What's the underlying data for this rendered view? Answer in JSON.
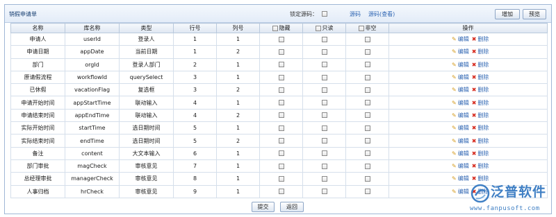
{
  "header": {
    "title": "销假申请单",
    "lock_label": "锁定源码：",
    "source_link": "源码",
    "source_view_link": "源码(查看)",
    "add_label": "增加",
    "preview_label": "预览"
  },
  "table": {
    "columns": [
      "名称",
      "库名称",
      "类型",
      "行号",
      "列号",
      "隐藏",
      "只读",
      "非空",
      "操作"
    ],
    "edit_label": "编辑",
    "delete_label": "删除",
    "rows": [
      {
        "name": "申请人",
        "db": "userId",
        "type": "登录人",
        "row": "1",
        "col": "1"
      },
      {
        "name": "申请日期",
        "db": "appDate",
        "type": "当前日期",
        "row": "1",
        "col": "2"
      },
      {
        "name": "部门",
        "db": "orgId",
        "type": "登录人部门",
        "row": "2",
        "col": "1"
      },
      {
        "name": "原请假流程",
        "db": "workflowId",
        "type": "querySelect",
        "row": "3",
        "col": "1"
      },
      {
        "name": "已休假",
        "db": "vacationFlag",
        "type": "复选框",
        "row": "3",
        "col": "2"
      },
      {
        "name": "申请开始时间",
        "db": "appStartTime",
        "type": "联动输入",
        "row": "4",
        "col": "1"
      },
      {
        "name": "申请结束时间",
        "db": "appEndTime",
        "type": "联动输入",
        "row": "4",
        "col": "2"
      },
      {
        "name": "实际开始时间",
        "db": "startTime",
        "type": "选日期时间",
        "row": "5",
        "col": "1"
      },
      {
        "name": "实际结束时间",
        "db": "endTime",
        "type": "选日期时间",
        "row": "5",
        "col": "2"
      },
      {
        "name": "备注",
        "db": "content",
        "type": "大文本输入",
        "row": "6",
        "col": "1"
      },
      {
        "name": "部门审批",
        "db": "magCheck",
        "type": "审核意见",
        "row": "7",
        "col": "1"
      },
      {
        "name": "总经理审批",
        "db": "managerCheck",
        "type": "审核意见",
        "row": "8",
        "col": "1"
      },
      {
        "name": "人事归档",
        "db": "hrCheck",
        "type": "审核意见",
        "row": "9",
        "col": "1"
      }
    ]
  },
  "footer": {
    "submit_label": "提交",
    "back_label": "返回"
  },
  "watermark": {
    "name": "泛普软件",
    "url": "www.fanpusoft.com"
  },
  "colors": {
    "accent": "#2f66b3",
    "header_bg": "#e3ecf8",
    "border": "#9fb7d6",
    "delete": "#d62a1e",
    "edit": "#d49a1d",
    "watermark": "#3f7fc4"
  }
}
